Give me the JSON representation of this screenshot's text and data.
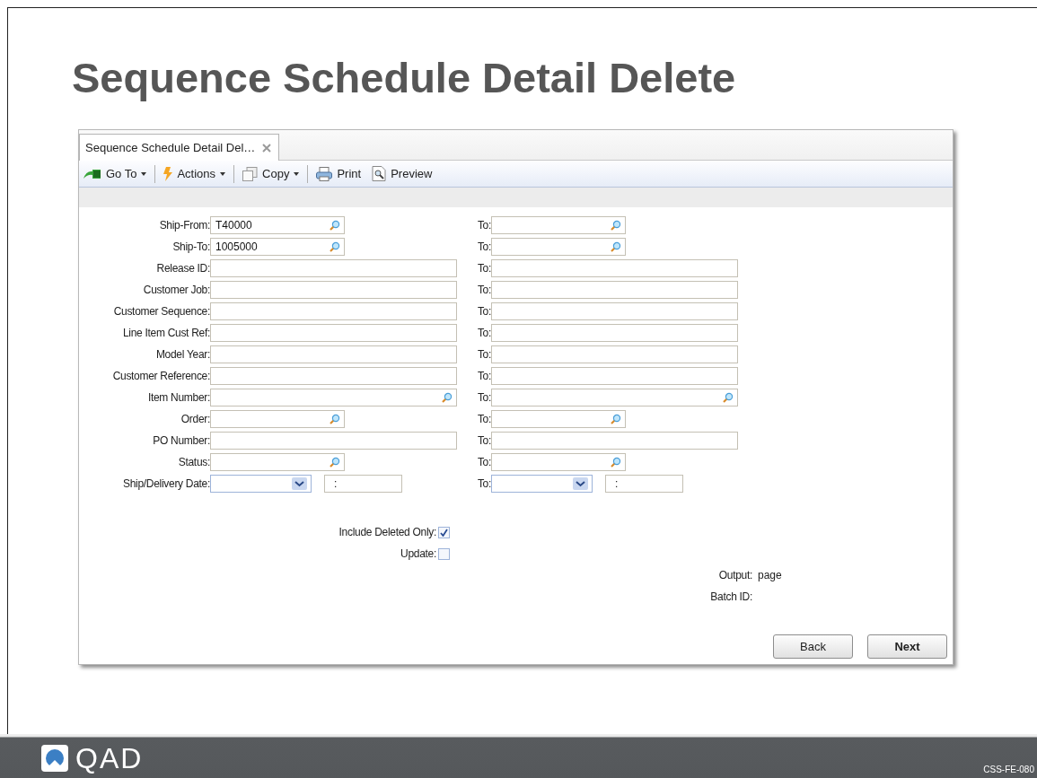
{
  "slide": {
    "title": "Sequence Schedule Detail Delete",
    "logo": "QAD",
    "code": "CSS-FE-080"
  },
  "window": {
    "tab": {
      "label": "Sequence Schedule Detail Del…",
      "selected": true
    },
    "toolbar": [
      {
        "label": "Go To",
        "kind": "goto",
        "menu": true
      },
      {
        "label": "Actions",
        "kind": "actions",
        "menu": true
      },
      {
        "label": "Copy",
        "kind": "copy",
        "menu": true
      },
      {
        "label": "Print",
        "kind": "print",
        "menu": false
      },
      {
        "label": "Preview",
        "kind": "preview",
        "menu": false
      }
    ],
    "rows": [
      {
        "label": "Ship-From:",
        "from": {
          "kind": "lookup",
          "value": "T40000"
        },
        "to_label": "To:",
        "to": {
          "kind": "lookup"
        }
      },
      {
        "label": "Ship-To:",
        "from": {
          "kind": "lookup",
          "value": "1005000"
        },
        "to_label": "To:",
        "to": {
          "kind": "lookup"
        }
      },
      {
        "label": "Release ID:",
        "from": {
          "kind": "text"
        },
        "to_label": "To:",
        "to": {
          "kind": "text"
        }
      },
      {
        "label": "Customer Job:",
        "from": {
          "kind": "text"
        },
        "to_label": "To:",
        "to": {
          "kind": "text"
        }
      },
      {
        "label": "Customer Sequence:",
        "from": {
          "kind": "text"
        },
        "to_label": "To:",
        "to": {
          "kind": "text"
        }
      },
      {
        "label": "Line Item Cust Ref:",
        "from": {
          "kind": "text"
        },
        "to_label": "To:",
        "to": {
          "kind": "text"
        }
      },
      {
        "label": "Model Year:",
        "from": {
          "kind": "text"
        },
        "to_label": "To:",
        "to": {
          "kind": "text"
        }
      },
      {
        "label": "Customer Reference:",
        "from": {
          "kind": "text"
        },
        "to_label": "To:",
        "to": {
          "kind": "text"
        }
      },
      {
        "label": "Item Number:",
        "from": {
          "kind": "wide-lookup"
        },
        "to_label": "To:",
        "to": {
          "kind": "wide-lookup"
        }
      },
      {
        "label": "Order:",
        "from": {
          "kind": "lookup"
        },
        "to_label": "To:",
        "to": {
          "kind": "lookup"
        }
      },
      {
        "label": "PO Number:",
        "from": {
          "kind": "text"
        },
        "to_label": "To:",
        "to": {
          "kind": "text"
        }
      },
      {
        "label": "Status:",
        "from": {
          "kind": "lookup"
        },
        "to_label": "To:",
        "to": {
          "kind": "lookup"
        }
      },
      {
        "label": "Ship/Delivery Date:",
        "from": {
          "kind": "date",
          "time": ":"
        },
        "to_label": "To:",
        "to": {
          "kind": "date",
          "time": ":"
        }
      }
    ],
    "options": [
      {
        "label": "Include Deleted Only:",
        "checked": true
      },
      {
        "label": "Update:",
        "checked": false
      }
    ],
    "info": [
      {
        "label": "Output:",
        "value": "page"
      },
      {
        "label": "Batch ID:"
      }
    ],
    "buttons": [
      {
        "label": "Back",
        "default": false
      },
      {
        "label": "Next",
        "default": true
      }
    ]
  }
}
